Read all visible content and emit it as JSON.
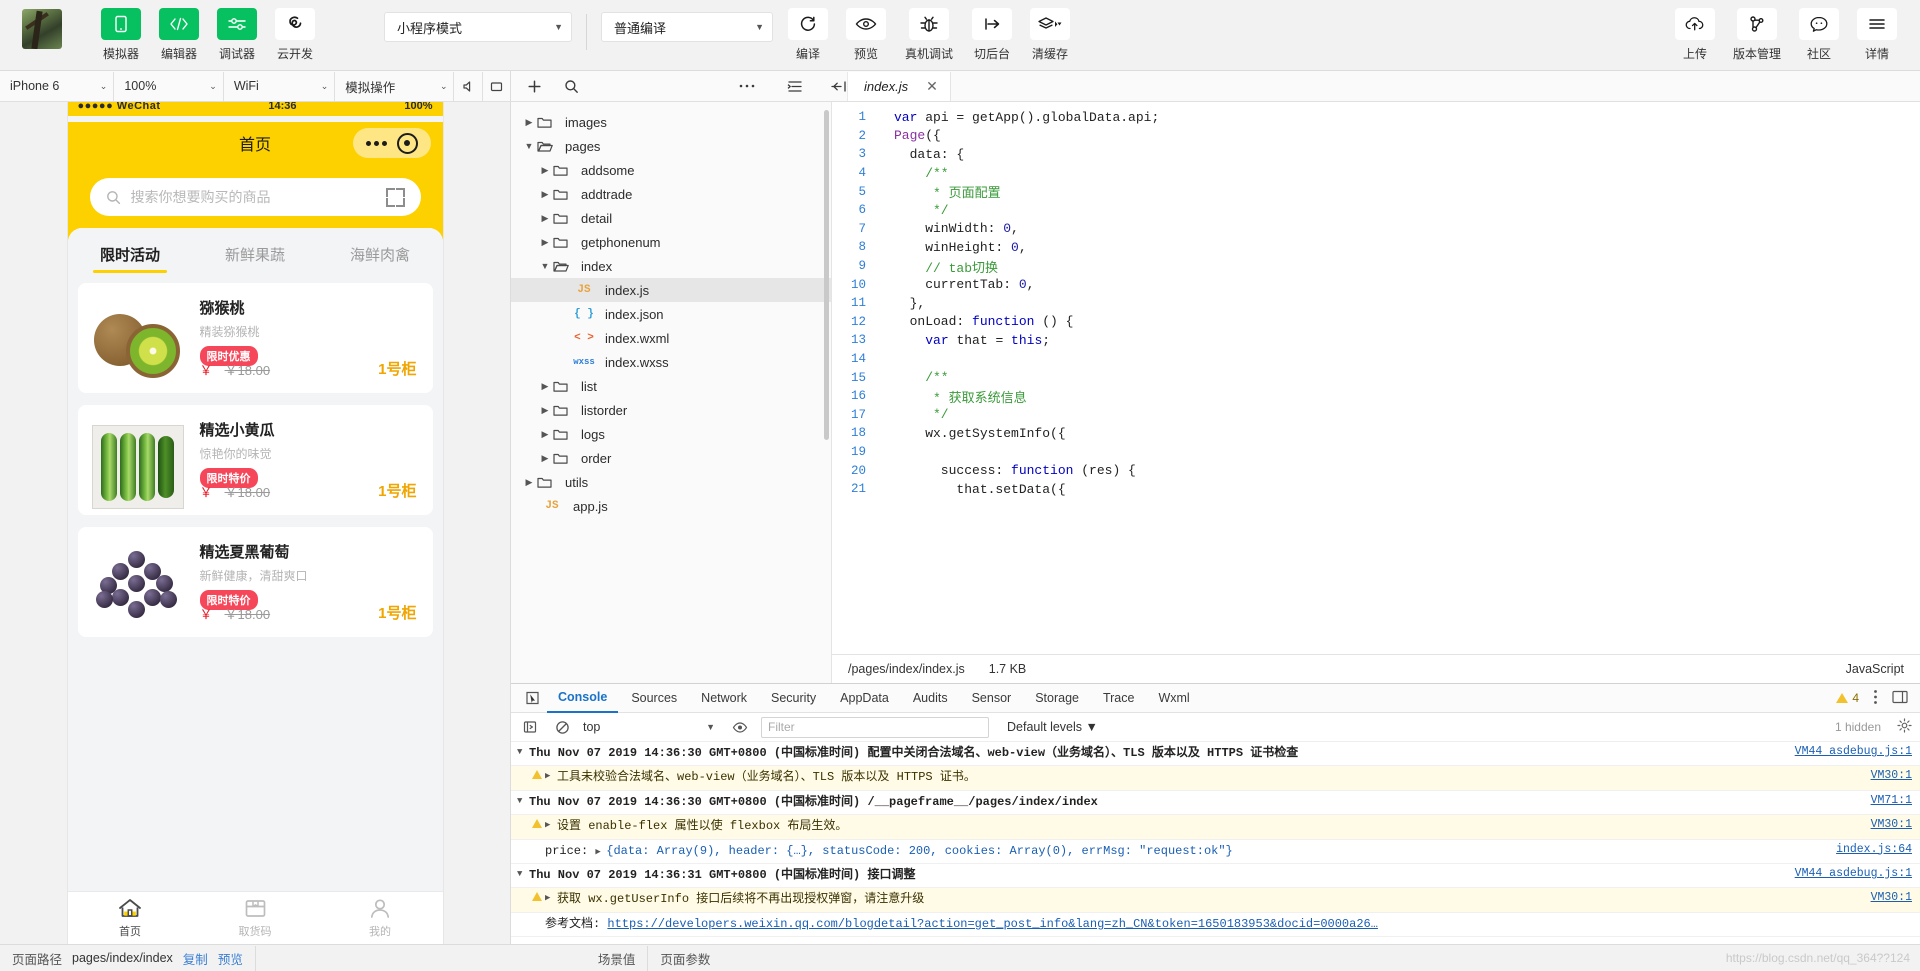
{
  "toolbar": {
    "items": [
      {
        "label": "模拟器",
        "icon": "simulator-icon",
        "active": true
      },
      {
        "label": "编辑器",
        "icon": "code-icon",
        "active": true
      },
      {
        "label": "调试器",
        "icon": "sliders-icon",
        "active": true
      },
      {
        "label": "云开发",
        "icon": "cloud-dev-icon",
        "active": false
      }
    ],
    "mode_select": "小程序模式",
    "compile_select": "普通编译",
    "actions": [
      {
        "label": "编译",
        "icon": "refresh-icon"
      },
      {
        "label": "预览",
        "icon": "eye-icon"
      },
      {
        "label": "真机调试",
        "icon": "bug-icon"
      },
      {
        "label": "切后台",
        "icon": "background-icon"
      },
      {
        "label": "清缓存",
        "icon": "layers-icon"
      }
    ],
    "right_actions": [
      {
        "label": "上传",
        "icon": "cloud-upload-icon"
      },
      {
        "label": "版本管理",
        "icon": "git-branch-icon"
      },
      {
        "label": "社区",
        "icon": "chat-icon"
      },
      {
        "label": "详情",
        "icon": "menu-icon"
      }
    ]
  },
  "simulator": {
    "device": "iPhone 6",
    "zoom": "100%",
    "network": "WiFi",
    "action": "模拟操作",
    "phone": {
      "status": {
        "carrier": "●●●●● WeChat",
        "time": "14:36",
        "battery": "100%"
      },
      "nav_title": "首页",
      "search_placeholder": "搜索你想要购买的商品",
      "tabs": [
        {
          "label": "限时活动",
          "active": true
        },
        {
          "label": "新鲜果蔬",
          "active": false
        },
        {
          "label": "海鲜肉禽",
          "active": false
        }
      ],
      "products": [
        {
          "name": "猕猴桃",
          "desc": "精装猕猴桃",
          "badge": "限时优惠",
          "currency": "￥",
          "old_price": "￥18.00",
          "unit": "1号柜",
          "art": "kiwi"
        },
        {
          "name": "精选小黄瓜",
          "desc": "惊艳你的味觉",
          "badge": "限时特价",
          "currency": "￥",
          "old_price": "￥18.00",
          "unit": "1号柜",
          "art": "cucumber"
        },
        {
          "name": "精选夏黑葡萄",
          "desc": "新鲜健康，清甜爽口",
          "badge": "限时特价",
          "currency": "￥",
          "old_price": "￥18.00",
          "unit": "1号柜",
          "art": "grape"
        }
      ],
      "tabbar": [
        {
          "label": "首页",
          "icon": "home-icon",
          "active": true
        },
        {
          "label": "取货码",
          "icon": "box-icon",
          "active": false
        },
        {
          "label": "我的",
          "icon": "person-icon",
          "active": false
        }
      ]
    }
  },
  "filetree": {
    "nodes": [
      {
        "label": "images",
        "type": "folder",
        "open": false,
        "depth": 1
      },
      {
        "label": "pages",
        "type": "folder",
        "open": true,
        "depth": 1
      },
      {
        "label": "addsome",
        "type": "folder",
        "open": false,
        "depth": 2
      },
      {
        "label": "addtrade",
        "type": "folder",
        "open": false,
        "depth": 2
      },
      {
        "label": "detail",
        "type": "folder",
        "open": false,
        "depth": 2
      },
      {
        "label": "getphonenum",
        "type": "folder",
        "open": false,
        "depth": 2
      },
      {
        "label": "index",
        "type": "folder",
        "open": true,
        "depth": 2
      },
      {
        "label": "index.js",
        "type": "js",
        "depth": 3,
        "selected": true
      },
      {
        "label": "index.json",
        "type": "json",
        "depth": 3
      },
      {
        "label": "index.wxml",
        "type": "wxml",
        "depth": 3
      },
      {
        "label": "index.wxss",
        "type": "wxss",
        "depth": 3
      },
      {
        "label": "list",
        "type": "folder",
        "open": false,
        "depth": 2
      },
      {
        "label": "listorder",
        "type": "folder",
        "open": false,
        "depth": 2
      },
      {
        "label": "logs",
        "type": "folder",
        "open": false,
        "depth": 2
      },
      {
        "label": "order",
        "type": "folder",
        "open": false,
        "depth": 2
      },
      {
        "label": "utils",
        "type": "folder",
        "open": false,
        "depth": 1
      },
      {
        "label": "app.js",
        "type": "js",
        "depth": 1
      }
    ]
  },
  "editor": {
    "tab_name": "index.js",
    "close_label": "✕",
    "footer_path": "/pages/index/index.js",
    "footer_size": "1.7 KB",
    "language": "JavaScript",
    "lines": [
      {
        "n": "1",
        "segs": [
          {
            "t": "var ",
            "c": "kw"
          },
          {
            "t": "api = getApp().globalData.api;",
            "c": ""
          }
        ]
      },
      {
        "n": "2",
        "segs": [
          {
            "t": "Page",
            "c": "fn"
          },
          {
            "t": "({",
            "c": ""
          }
        ]
      },
      {
        "n": "3",
        "segs": [
          {
            "t": "  data: {",
            "c": ""
          }
        ]
      },
      {
        "n": "4",
        "segs": [
          {
            "t": "    /**",
            "c": "cmt"
          }
        ]
      },
      {
        "n": "5",
        "segs": [
          {
            "t": "     * 页面配置",
            "c": "cmt"
          }
        ]
      },
      {
        "n": "6",
        "segs": [
          {
            "t": "     */",
            "c": "cmt"
          }
        ]
      },
      {
        "n": "7",
        "segs": [
          {
            "t": "    winWidth: ",
            "c": ""
          },
          {
            "t": "0",
            "c": "num"
          },
          {
            "t": ",",
            "c": ""
          }
        ]
      },
      {
        "n": "8",
        "segs": [
          {
            "t": "    winHeight: ",
            "c": ""
          },
          {
            "t": "0",
            "c": "num"
          },
          {
            "t": ",",
            "c": ""
          }
        ]
      },
      {
        "n": "9",
        "segs": [
          {
            "t": "    // tab切换",
            "c": "cmt"
          }
        ]
      },
      {
        "n": "10",
        "segs": [
          {
            "t": "    currentTab: ",
            "c": ""
          },
          {
            "t": "0",
            "c": "num"
          },
          {
            "t": ",",
            "c": ""
          }
        ]
      },
      {
        "n": "11",
        "segs": [
          {
            "t": "  },",
            "c": ""
          }
        ]
      },
      {
        "n": "12",
        "segs": [
          {
            "t": "  onLoad: ",
            "c": ""
          },
          {
            "t": "function",
            "c": "kw"
          },
          {
            "t": " () {",
            "c": ""
          }
        ]
      },
      {
        "n": "13",
        "segs": [
          {
            "t": "    ",
            "c": ""
          },
          {
            "t": "var ",
            "c": "kw"
          },
          {
            "t": "that = ",
            "c": ""
          },
          {
            "t": "this",
            "c": "kw"
          },
          {
            "t": ";",
            "c": ""
          }
        ]
      },
      {
        "n": "14",
        "segs": [
          {
            "t": "",
            "c": ""
          }
        ]
      },
      {
        "n": "15",
        "segs": [
          {
            "t": "    /**",
            "c": "cmt"
          }
        ]
      },
      {
        "n": "16",
        "segs": [
          {
            "t": "     * 获取系统信息",
            "c": "cmt"
          }
        ]
      },
      {
        "n": "17",
        "segs": [
          {
            "t": "     */",
            "c": "cmt"
          }
        ]
      },
      {
        "n": "18",
        "segs": [
          {
            "t": "    wx.getSystemInfo({",
            "c": ""
          }
        ]
      },
      {
        "n": "19",
        "segs": [
          {
            "t": "",
            "c": ""
          }
        ]
      },
      {
        "n": "20",
        "segs": [
          {
            "t": "      success: ",
            "c": ""
          },
          {
            "t": "function",
            "c": "kw"
          },
          {
            "t": " (res) {",
            "c": ""
          }
        ]
      },
      {
        "n": "21",
        "segs": [
          {
            "t": "        that.setData({",
            "c": ""
          }
        ]
      }
    ]
  },
  "devtools": {
    "tabs": [
      {
        "label": "Console",
        "active": true
      },
      {
        "label": "Sources",
        "active": false
      },
      {
        "label": "Network",
        "active": false
      },
      {
        "label": "Security",
        "active": false
      },
      {
        "label": "AppData",
        "active": false
      },
      {
        "label": "Audits",
        "active": false
      },
      {
        "label": "Sensor",
        "active": false
      },
      {
        "label": "Storage",
        "active": false
      },
      {
        "label": "Trace",
        "active": false
      },
      {
        "label": "Wxml",
        "active": false
      }
    ],
    "warning_count": "4",
    "context": "top",
    "filter_placeholder": "Filter",
    "levels": "Default levels",
    "hidden_label": "1 hidden",
    "prompt": ">",
    "logs": [
      {
        "type": "group",
        "text": "Thu Nov 07 2019 14:36:30 GMT+0800 (中国标准时间) 配置中关闭合法域名、web-view（业务域名）、TLS 版本以及 HTTPS 证书检查",
        "source": "VM44 asdebug.js:1"
      },
      {
        "type": "warn",
        "text": "工具未校验合法域名、web-view（业务域名）、TLS 版本以及 HTTPS 证书。",
        "source": "VM30:1"
      },
      {
        "type": "group",
        "text": "Thu Nov 07 2019 14:36:30 GMT+0800 (中国标准时间) /__pageframe__/pages/index/index",
        "source": "VM71:1"
      },
      {
        "type": "warn",
        "text": "设置 enable-flex 属性以使 flexbox 布局生效。",
        "source": "VM30:1"
      },
      {
        "type": "object",
        "label": "price:",
        "text": "{data: Array(9), header: {…}, statusCode: 200, cookies: Array(0), errMsg: \"request:ok\"}",
        "source": "index.js:64"
      },
      {
        "type": "group",
        "text": "Thu Nov 07 2019 14:36:31 GMT+0800 (中国标准时间) 接口调整",
        "source": "VM44 asdebug.js:1"
      },
      {
        "type": "warn",
        "text": "获取 wx.getUserInfo 接口后续将不再出现授权弹窗，请注意升级",
        "source": "VM30:1"
      },
      {
        "type": "link",
        "text": "参考文档: https://developers.weixin.qq.com/blogdetail?action=get_post_info&lang=zh_CN&token=1650183953&docid=0000a26…",
        "source": ""
      }
    ]
  },
  "statusbar": {
    "path_label": "页面路径",
    "path_value": "pages/index/index",
    "copy": "复制",
    "preview": "预览",
    "scene": "场景值",
    "params": "页面参数",
    "watermark": "https://blog.csdn.net/qq_364??124"
  }
}
